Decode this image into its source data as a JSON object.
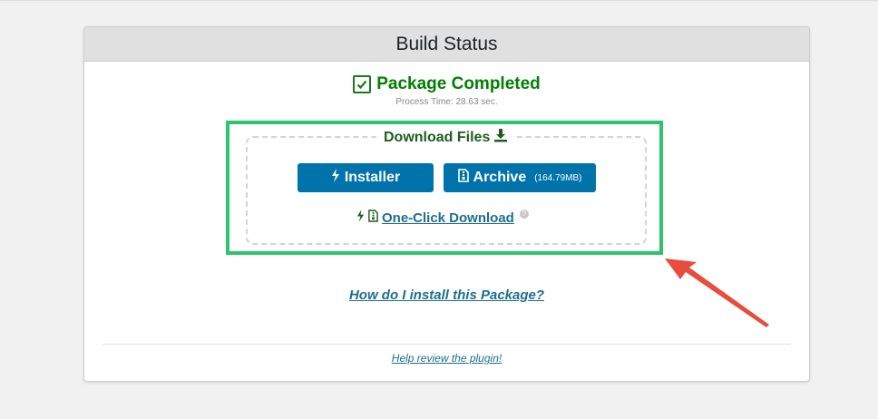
{
  "panel": {
    "title": "Build Status",
    "status": "Package Completed",
    "process_time": "Process Time: 28.63 sec."
  },
  "download": {
    "title": "Download Files",
    "installer_label": "Installer",
    "archive_label": "Archive",
    "archive_size": "(164.79MB)",
    "one_click_label": "One-Click Download"
  },
  "links": {
    "install_help": "How do I install this Package?",
    "review": "Help review the plugin!"
  },
  "colors": {
    "accent_blue": "#0073aa",
    "success_green": "#008000",
    "highlight_frame": "#2ec46c",
    "arrow_red": "#e74c3c"
  },
  "icons": [
    "check-icon",
    "download-icon",
    "bolt-icon",
    "archive-file-icon",
    "help-icon",
    "red-arrow"
  ]
}
